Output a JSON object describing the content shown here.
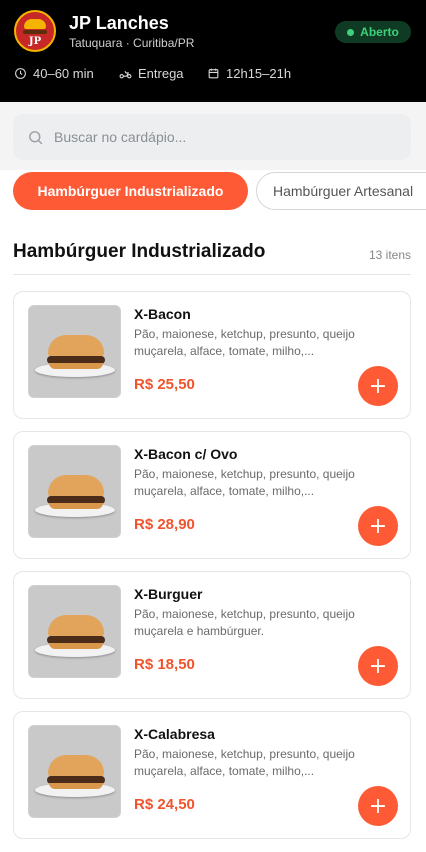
{
  "store": {
    "name": "JP Lanches",
    "location": "Tatuquara · Curitiba/PR",
    "status": "Aberto",
    "logo_text": "JP",
    "delivery_time": "40–60 min",
    "delivery_mode": "Entrega",
    "hours": "12h15–21h"
  },
  "search": {
    "placeholder": "Buscar no cardápio..."
  },
  "categories": [
    {
      "label": "Hambúrguer Industrializado",
      "active": true
    },
    {
      "label": "Hambúrguer Artesanal",
      "active": false
    }
  ],
  "section": {
    "title": "Hambúrguer Industrializado",
    "count": "13 itens"
  },
  "items": [
    {
      "name": "X-Bacon",
      "description": "Pão, maionese, ketchup, presunto, queijo muçarela, alface, tomate, milho,...",
      "price": "R$ 25,50"
    },
    {
      "name": "X-Bacon c/ Ovo",
      "description": "Pão, maionese, ketchup, presunto, queijo muçarela, alface, tomate, milho,...",
      "price": "R$ 28,90"
    },
    {
      "name": "X-Burguer",
      "description": "Pão, maionese, ketchup, presunto, queijo muçarela e hambúrguer.",
      "price": "R$ 18,50"
    },
    {
      "name": "X-Calabresa",
      "description": "Pão, maionese, ketchup, presunto, queijo muçarela, alface, tomate, milho,...",
      "price": "R$ 24,50"
    }
  ],
  "add_symbol": "+",
  "colors": {
    "accent": "#ff5a36",
    "price": "#f0542d",
    "status": "#3ed07a",
    "header": "#000000"
  },
  "icons": {
    "time": "clock-icon",
    "delivery": "motorcycle-icon",
    "hours": "calendar-icon",
    "search": "search-icon"
  }
}
